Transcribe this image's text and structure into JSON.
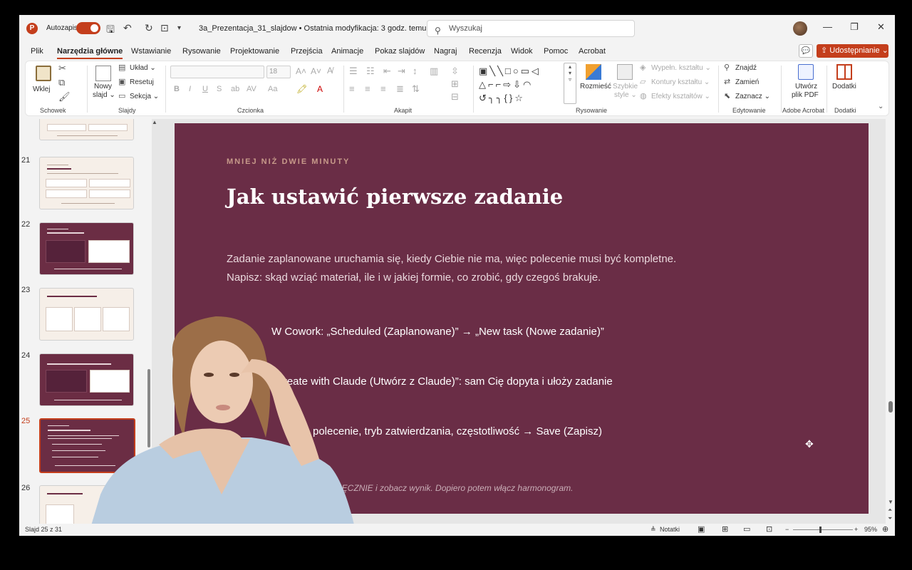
{
  "app": {
    "autosave_label": "Autozapis",
    "document_title": "3a_Prezentacja_31_slajdow • Ostatnia modyfikacja: 3 godz. temu ⌄",
    "search_placeholder": "Wyszukaj"
  },
  "menu": {
    "tabs": [
      "Plik",
      "Narzędzia główne",
      "Wstawianie",
      "Rysowanie",
      "Projektowanie",
      "Przejścia",
      "Animacje",
      "Pokaz slajdów",
      "Nagraj",
      "Recenzja",
      "Widok",
      "Pomoc",
      "Acrobat"
    ],
    "active_index": 1,
    "share_label": "Udostępnianie ⌄"
  },
  "ribbon": {
    "paste": "Wklej",
    "clipboard_group": "Schowek",
    "new_slide": "Nowy",
    "new_slide2": "slajd ⌄",
    "layout": "Układ ⌄",
    "reset": "Resetuj",
    "section": "Sekcja ⌄",
    "slides_group": "Slajdy",
    "font_size": "18",
    "font_group": "Czcionka",
    "paragraph_group": "Akapit",
    "arrange": "Rozmieść",
    "quick_styles": "Szybkie",
    "quick_styles2": "style ⌄",
    "shape_fill": "Wypełn. kształtu ⌄",
    "shape_outline": "Kontury kształtu ⌄",
    "shape_effects": "Efekty kształtów ⌄",
    "drawing_group": "Rysowanie",
    "find": "Znajdź",
    "replace": "Zamień",
    "select": "Zaznacz ⌄",
    "editing_group": "Edytowanie",
    "create_pdf": "Utwórz",
    "create_pdf2": "plik PDF",
    "acrobat_group": "Adobe Acrobat",
    "addins": "Dodatki",
    "addins_group": "Dodatki"
  },
  "thumbnails": [
    {
      "num": "21",
      "theme": "light"
    },
    {
      "num": "22",
      "theme": "dark"
    },
    {
      "num": "23",
      "theme": "light"
    },
    {
      "num": "24",
      "theme": "dark"
    },
    {
      "num": "25",
      "theme": "dark",
      "selected": true
    },
    {
      "num": "26",
      "theme": "light"
    }
  ],
  "slide": {
    "eyebrow": "MNIEJ NIŻ DWIE MINUTY",
    "title": "Jak ustawić pierwsze zadanie",
    "body_line1": "Zadanie zaplanowane uruchamia się, kiedy Ciebie nie ma, więc polecenie musi być kompletne.",
    "body_line2": "Napisz: skąd wziąć materiał, ile i w jakiej formie, co zrobić, gdy czegoś brakuje.",
    "step1": "W Cowork: „Scheduled (Zaplanowane)” → „New task (Nowe zadanie)”",
    "step2": "Create with Claude (Utwórz z Claude)”: sam Cię dopyta i ułoży zadanie",
    "step3": "polecenie, tryb zatwierdzania, częstotliwość → Save (Zapisz)",
    "footer": "RĘCZNIE i zobacz wynik. Dopiero potem włącz harmonogram."
  },
  "status": {
    "slide_counter": "Slajd 25 z 31",
    "notes": "Notatki",
    "zoom": "95%"
  },
  "colors": {
    "accent": "#c43e1c",
    "slide_bg": "#6a2d46"
  }
}
